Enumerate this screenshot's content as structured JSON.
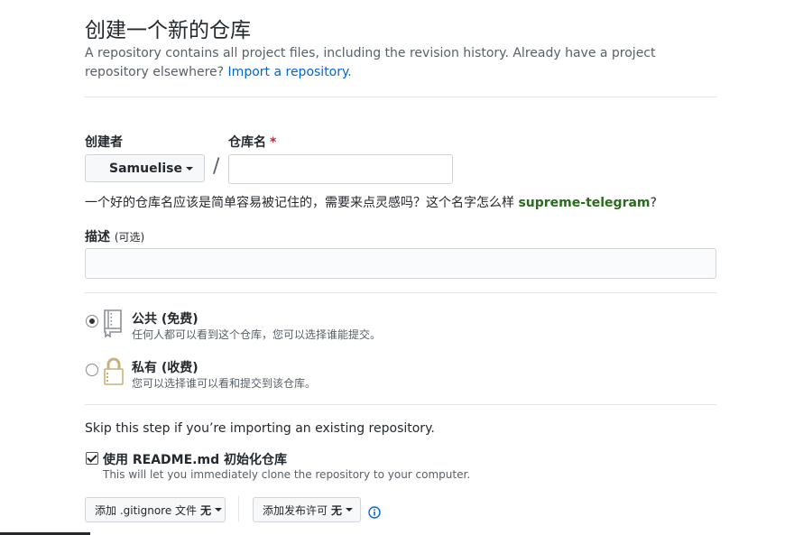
{
  "header": {
    "title": "创建一个新的仓库",
    "subtitle": "A repository contains all project files, including the revision history. Already have a project repository elsewhere?",
    "import_link": "Import a repository."
  },
  "owner": {
    "label": "创建者",
    "value": "Samuelise"
  },
  "repo_name": {
    "label": "仓库名",
    "required_mark": "*",
    "value": "",
    "placeholder": ""
  },
  "separator": "/",
  "suggestion": {
    "text": "一个好的仓库名应该是简单容易被记住的，需要来点灵感吗？这个名字怎么样",
    "name": "supreme-telegram",
    "suffix": "?"
  },
  "description": {
    "label": "描述",
    "optional": "(可选)",
    "value": ""
  },
  "visibility": {
    "public": {
      "title": "公共 (免费)",
      "desc": "任何人都可以看到这个仓库，您可以选择谁能提交。",
      "selected": true,
      "icon": "repo-book-icon"
    },
    "private": {
      "title": "私有 (收费)",
      "desc": "您可以选择谁可以看和提交到该仓库。",
      "selected": false,
      "icon": "lock-icon"
    }
  },
  "skip_text": "Skip this step if you’re importing an existing repository.",
  "init_readme": {
    "label": "使用 README.md 初始化仓库",
    "desc": "This will let you immediately clone the repository to your computer.",
    "checked": true
  },
  "gitignore_button": {
    "label": "添加 .gitignore 文件",
    "value": "无"
  },
  "license_button": {
    "label": "添加发布许可",
    "value": "无"
  },
  "colors": {
    "link": "#0366d6",
    "suggestion": "#2a6b1f",
    "required": "#cb2431",
    "icon_gold": "#c6b27a"
  }
}
